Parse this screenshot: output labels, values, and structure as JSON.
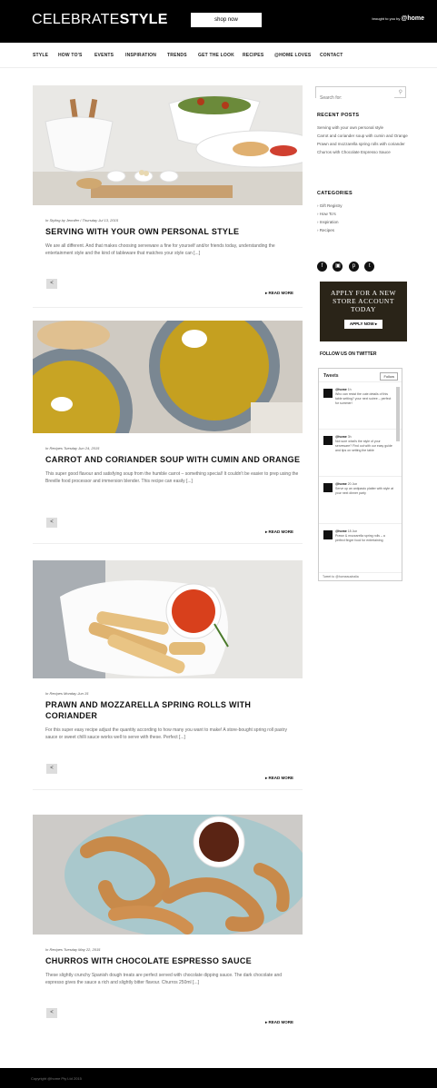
{
  "header": {
    "logo_light": "CELEBRATE",
    "logo_bold": "STYLE",
    "shop_now": "shop now",
    "brought_prefix": "brought to you by",
    "brand": "home"
  },
  "nav": [
    "STYLE",
    "HOW TO'S",
    "EVENTS",
    "INSPIRATION",
    "TRENDS",
    "GET THE LOOK",
    "RECIPES",
    "@HOME LOVES",
    "CONTACT"
  ],
  "posts": [
    {
      "meta": "In Styling by Jennifer / Thursday Jul 13, 2015",
      "title": "SERVING WITH YOUR OWN PERSONAL STYLE",
      "excerpt": "We are all different. And that makes choosing serveware a fine for yourself and/or friends today, understanding the entertainment style and the kind of tableware that matches your style can [...]",
      "readmore": "READ MORE"
    },
    {
      "meta": "In Recipes Tuesday Jun 24, 2015",
      "title": "CARROT AND CORIANDER SOUP WITH CUMIN AND ORANGE",
      "excerpt": "This super good flavour and satisfying soup from the humble carrot – something special! It couldn't be easier to prep using the Breville food processor and immersion blender. This recipe can easily [...]",
      "readmore": "READ MORE"
    },
    {
      "meta": "In Recipes Monday Jun 15",
      "title": "PRAWN AND MOZZARELLA SPRING ROLLS WITH CORIANDER",
      "excerpt": "For this super easy recipe adjust the quantity according to how many you want to make! A store-bought spring roll pastry sauce or sweet chilli sauce works well to serve with these. Perfect [...]",
      "readmore": "READ MORE"
    },
    {
      "meta": "In Recipes Tuesday May 22, 2015",
      "title": "CHURROS WITH CHOCOLATE ESPRESSO SAUCE",
      "excerpt": "These slightly crunchy Spanish dough treats are perfect served with chocolate dipping sauce. The dark chocolate and espresso gives the sauce a rich and slightly bitter flavour. Churros 250ml [...]",
      "readmore": "READ MORE"
    }
  ],
  "sidebar": {
    "search_placeholder": "Search for:",
    "recent_head": "RECENT POSTS",
    "recent": [
      "Serving with your own personal style",
      "Carrot and coriander soup with cumin and Orange",
      "Prawn and mozzarella spring rolls with coriander",
      "Churros with Chocolate Espresso Sauce"
    ],
    "cat_head": "CATEGORIES",
    "categories": [
      "Gift Registry",
      "How To's",
      "Inspiration",
      "Recipes"
    ],
    "social_icons": [
      "facebook-icon",
      "instagram-icon",
      "pinterest-icon",
      "twitter-icon"
    ],
    "ad_line1": "APPLY FOR A NEW",
    "ad_line2": "STORE ACCOUNT",
    "ad_line3": "TODAY",
    "ad_button": "APPLY NOW",
    "twitter_head": "FOLLOW US ON TWITTER",
    "tweets_label": "Tweets",
    "follow_label": "Follow",
    "tweets": [
      {
        "name": "@home",
        "text": "Who can resist the cute details of this table setting? your next soiree – perfect for summer!",
        "time": "1h"
      },
      {
        "name": "@home",
        "text": "Not sure what's the style of your serveware? Find out with our easy guide and tips on setting the table",
        "time": "3h"
      },
      {
        "name": "@home",
        "text": "Serve up an antipasto platter with style at your next dinner party",
        "time": "20 Jun"
      },
      {
        "name": "@home",
        "text": "Prawn & mozzarella spring rolls – a perfect finger food for entertaining",
        "time": "18 Jun"
      }
    ],
    "tw_foot": "Tweet to @homeaustralia"
  },
  "footer": "Copyright @home Pty Ltd 2015"
}
